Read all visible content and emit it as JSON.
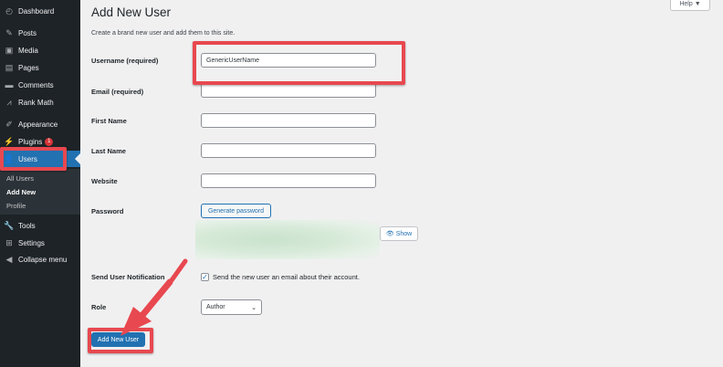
{
  "sidebar": {
    "items": [
      {
        "label": "Dashboard",
        "icon": "dashboard-icon"
      },
      {
        "label": "Posts",
        "icon": "pin-icon"
      },
      {
        "label": "Media",
        "icon": "media-icon"
      },
      {
        "label": "Pages",
        "icon": "pages-icon"
      },
      {
        "label": "Comments",
        "icon": "comments-icon"
      },
      {
        "label": "Rank Math",
        "icon": "rank-math-icon"
      },
      {
        "label": "Appearance",
        "icon": "paintbrush-icon"
      },
      {
        "label": "Plugins",
        "icon": "plugins-icon",
        "badge": "1"
      },
      {
        "label": "Users",
        "icon": "users-icon"
      },
      {
        "label": "Tools",
        "icon": "wrench-icon"
      },
      {
        "label": "Settings",
        "icon": "settings-icon"
      },
      {
        "label": "Collapse menu",
        "icon": "collapse-icon"
      }
    ],
    "users_submenu": [
      "All Users",
      "Add New",
      "Profile"
    ]
  },
  "header": {
    "help_label": "Help ▼"
  },
  "main": {
    "title": "Add New User",
    "description": "Create a brand new user and add them to this site.",
    "fields": {
      "username_label": "Username (required)",
      "username_value": "GenericUserName",
      "email_label": "Email (required)",
      "first_name_label": "First Name",
      "last_name_label": "Last Name",
      "website_label": "Website",
      "password_label": "Password",
      "generate_password_label": "Generate password",
      "show_label": "Show",
      "notification_label": "Send User Notification",
      "notification_text": "Send the new user an email about their account.",
      "notification_checked": true,
      "role_label": "Role",
      "role_value": "Author"
    },
    "submit_label": "Add New User"
  },
  "colors": {
    "accent": "#2271b1",
    "sidebar": "#1d2327",
    "annotation": "#e8484f"
  }
}
